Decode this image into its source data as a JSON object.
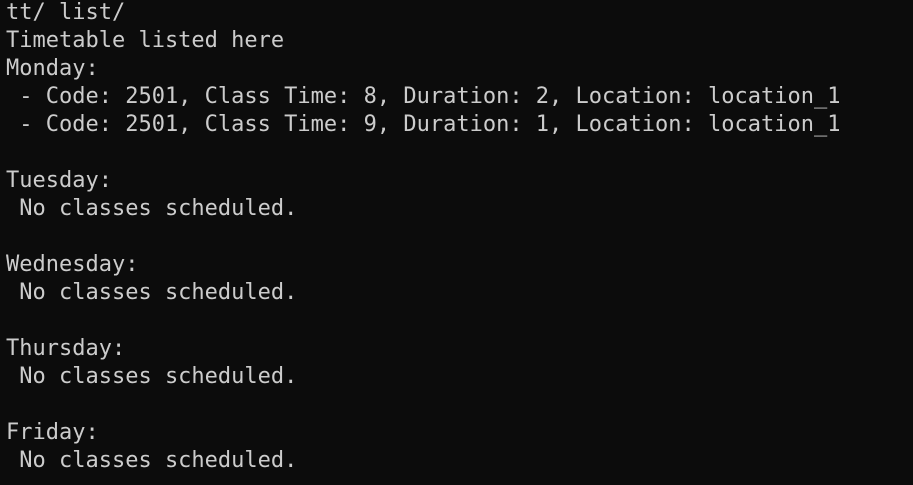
{
  "terminal": {
    "background": "#0c0c0c",
    "foreground": "#cccccc",
    "lines": [
      "tt/ list/",
      "Timetable listed here",
      "Monday:",
      " - Code: 2501, Class Time: 8, Duration: 2, Location: location_1",
      " - Code: 2501, Class Time: 9, Duration: 1, Location: location_1",
      "",
      "Tuesday:",
      " No classes scheduled.",
      "",
      "Wednesday:",
      " No classes scheduled.",
      "",
      "Thursday:",
      " No classes scheduled.",
      "",
      "Friday:",
      " No classes scheduled."
    ]
  }
}
